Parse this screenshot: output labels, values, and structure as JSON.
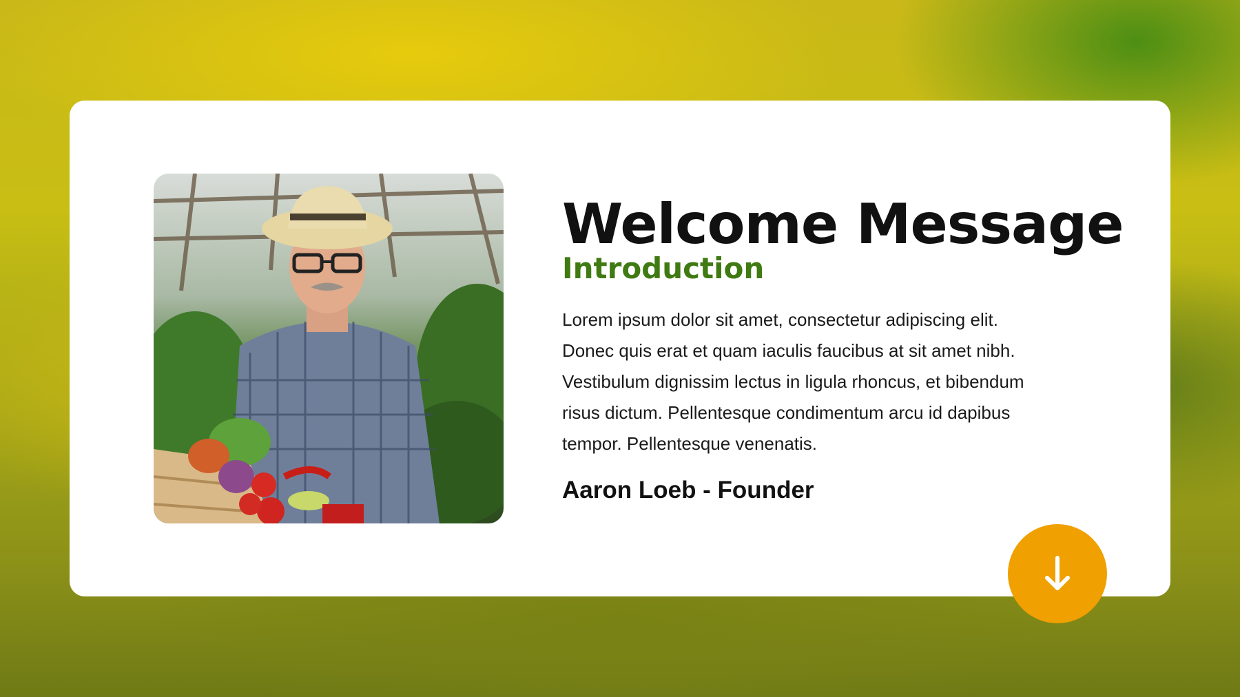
{
  "slide": {
    "title": "Welcome Message",
    "subtitle": "Introduction",
    "body_lines": [
      "Lorem ipsum dolor sit amet, consectetur adipiscing elit.",
      "Donec quis erat et quam iaculis faucibus at sit amet nibh.",
      "Vestibulum dignissim lectus in ligula rhoncus, et bibendum",
      "risus dictum. Pellentesque condimentum arcu id dapibus",
      "tempor. Pellentesque venenatis."
    ],
    "signature": "Aaron Loeb - Founder"
  },
  "photo": {
    "subject": "smiling older farmer in a straw hat and plaid shirt holding a crate of vegetables in a greenhouse"
  },
  "scroll_button": {
    "icon": "arrow-down-icon"
  },
  "colors": {
    "title": "#111111",
    "subtitle_accent": "#3f7a12",
    "button_accent": "#f0a000",
    "card_background": "#ffffff"
  }
}
